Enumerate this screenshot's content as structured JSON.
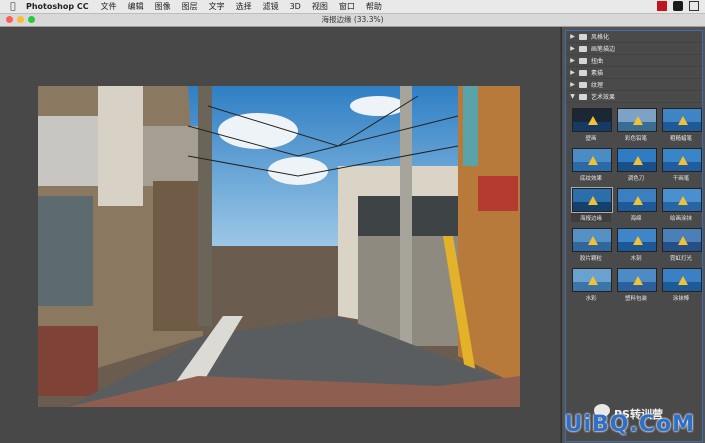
{
  "menubar": {
    "app_name": "Photoshop CC",
    "items": [
      "文件",
      "编辑",
      "图像",
      "图层",
      "文字",
      "选择",
      "滤镜",
      "3D",
      "视图",
      "窗口",
      "帮助"
    ]
  },
  "window": {
    "title": "海报边缘 (33.3%)"
  },
  "filter_gallery": {
    "folders": [
      "风格化",
      "画笔描边",
      "扭曲",
      "素描",
      "纹理",
      "艺术效果"
    ],
    "open_folder_index": 5,
    "thumbnails": [
      "壁画",
      "彩色铅笔",
      "粗糙蜡笔",
      "底纹效果",
      "调色刀",
      "干画笔",
      "海报边缘",
      "海绵",
      "绘画涂抹",
      "胶片颗粒",
      "木刻",
      "霓虹灯光",
      "水彩",
      "塑料包装",
      "涂抹棒"
    ],
    "selected_index": 6
  },
  "watermark": {
    "text": "UiBQ.CoM",
    "sub": "PS转训营"
  },
  "colors": {
    "accent": "#3a6fb5",
    "watermark": "#2f6fc8"
  }
}
